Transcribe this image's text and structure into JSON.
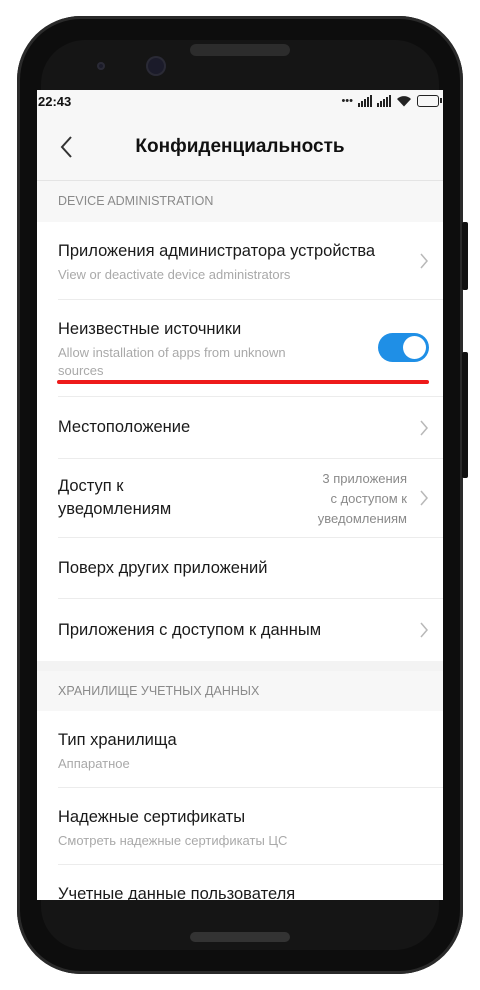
{
  "status_bar": {
    "time": "22:43"
  },
  "header": {
    "title": "Конфиденциальность"
  },
  "sections": [
    {
      "header": "DEVICE ADMINISTRATION",
      "items": [
        {
          "label": "Приложения администратора устройства",
          "subtitle": "View or deactivate device administrators"
        },
        {
          "label": "Неизвестные источники",
          "subtitle_line1": "Allow installation of apps from unknown",
          "subtitle_line2": "sources",
          "toggle_on": true
        },
        {
          "label": "Местоположение"
        },
        {
          "label_line1": "Доступ к",
          "label_line2": "уведомлениям",
          "value_line1": "3 приложения",
          "value_line2": "с доступом к",
          "value_line3": "уведомлениям"
        },
        {
          "label": "Поверх других приложений"
        },
        {
          "label": "Приложения с доступом к данным"
        }
      ]
    },
    {
      "header": "ХРАНИЛИЩЕ УЧЕТНЫХ ДАННЫХ",
      "items": [
        {
          "label": "Тип хранилища",
          "subtitle": "Аппаратное"
        },
        {
          "label": "Надежные сертификаты",
          "subtitle": "Смотреть надежные сертификаты ЦС"
        },
        {
          "label": "Учетные данные пользователя"
        }
      ]
    }
  ],
  "colors": {
    "accent": "#1f8fe6",
    "annotation": "#ee1a1a"
  }
}
